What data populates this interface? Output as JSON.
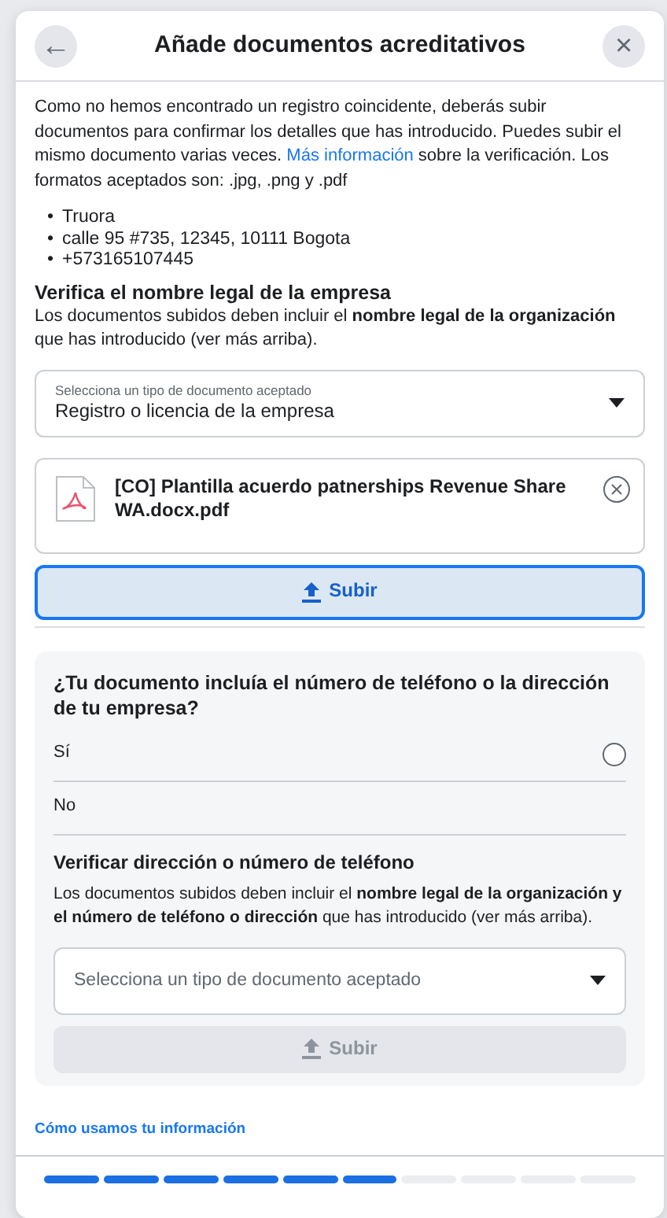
{
  "dialog": {
    "title": "Añade documentos acreditativos",
    "back_label": "←",
    "close_label": "×"
  },
  "intro": "Como no hemos encontrado un registro coincidente, deberás subir documentos para confirmar los detalles que has introducido. Puedes subir el mismo documento varias veces. ",
  "intro_link": "Más información",
  "intro_after": " sobre la verificación. Los formatos aceptados son: .jpg, .png y .pdf",
  "details": [
    {
      "marker": "•",
      "text": "Truora"
    },
    {
      "marker": "•",
      "text": "calle 95 #735, 12345, 10111 Bogota"
    },
    {
      "marker": "•",
      "text": "+573165107445"
    }
  ],
  "legal_section": {
    "heading": "Verifica el nombre legal de la empresa",
    "text": "Los documentos subidos deben incluir el **nombre legal de la organización** que has introducido (ver más arriba).",
    "select": {
      "label": "Selecciona un tipo de documento aceptado",
      "value": "Registro o licencia de la empresa"
    },
    "file": {
      "name": "[CO] Plantilla acuerdo patnerships Revenue Share WA.docx.pdf"
    },
    "upload": {
      "label": "Subir",
      "disabled": false
    }
  },
  "phone_section": {
    "question": "¿Tu documento incluía el número de teléfono o la dirección de tu empresa?",
    "options": [
      {
        "label": "Sí",
        "kind": "radio",
        "selected": false
      },
      {
        "label": "No",
        "kind": "plain",
        "selected": false
      }
    ],
    "heading": "Verificar dirección o número de teléfono",
    "text": "Los documentos subidos deben incluir el **nombre legal de la organización y el número de teléfono o dirección** que has introducido (ver más arriba).",
    "select": {
      "placeholder": "Selecciona un tipo de documento aceptado"
    },
    "upload": {
      "label": "Subir",
      "disabled": true
    }
  },
  "footer_link": "Cómo usamos tu información",
  "progress": [
    {
      "done": true
    },
    {
      "done": true
    },
    {
      "done": true
    },
    {
      "done": true
    },
    {
      "done": true
    },
    {
      "done": true
    },
    {
      "done": false
    },
    {
      "done": false
    },
    {
      "done": false
    },
    {
      "done": false
    }
  ]
}
